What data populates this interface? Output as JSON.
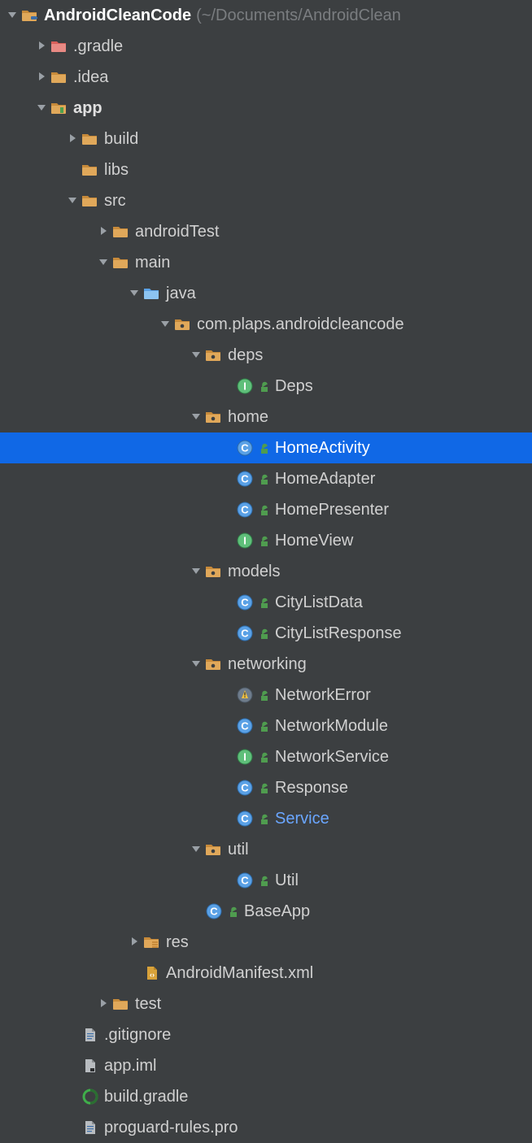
{
  "root": {
    "label": "AndroidCleanCode",
    "path_suffix": "(~/Documents/AndroidClean"
  },
  "tree": {
    "gradle_dir": ".gradle",
    "idea_dir": ".idea",
    "app": {
      "label": "app",
      "build": "build",
      "libs": "libs",
      "src": {
        "label": "src",
        "androidTest": "androidTest",
        "main": {
          "label": "main",
          "java": {
            "label": "java",
            "pkg": {
              "label": "com.plaps.androidcleancode",
              "deps": {
                "label": "deps",
                "Deps": "Deps"
              },
              "home": {
                "label": "home",
                "HomeActivity": "HomeActivity",
                "HomeAdapter": "HomeAdapter",
                "HomePresenter": "HomePresenter",
                "HomeView": "HomeView"
              },
              "models": {
                "label": "models",
                "CityListData": "CityListData",
                "CityListResponse": "CityListResponse"
              },
              "networking": {
                "label": "networking",
                "NetworkError": "NetworkError",
                "NetworkModule": "NetworkModule",
                "NetworkService": "NetworkService",
                "Response": "Response",
                "Service": "Service"
              },
              "util": {
                "label": "util",
                "Util": "Util"
              },
              "BaseApp": "BaseApp"
            }
          },
          "res": "res",
          "manifest": "AndroidManifest.xml"
        },
        "test": "test"
      },
      "gitignore": ".gitignore",
      "app_iml": "app.iml",
      "build_gradle": "build.gradle",
      "proguard": "proguard-rules.pro"
    }
  }
}
